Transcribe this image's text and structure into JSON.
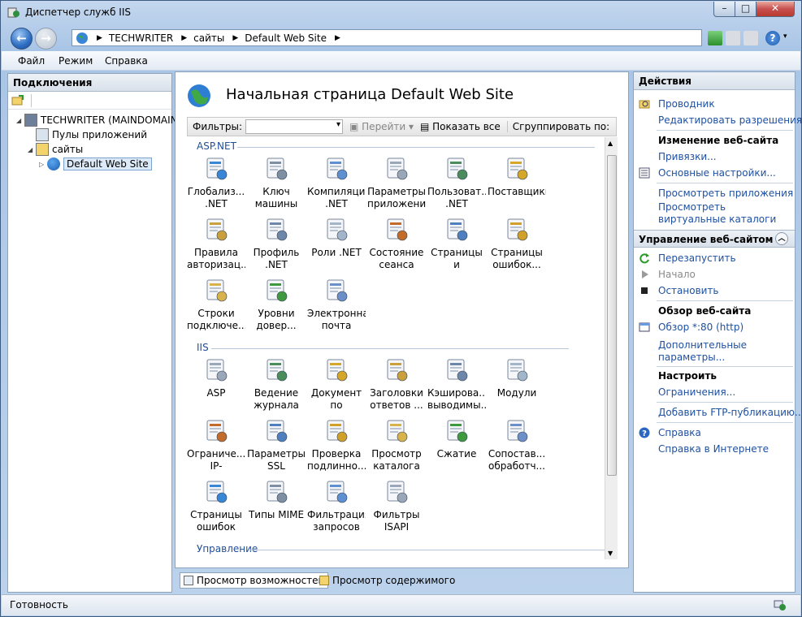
{
  "window": {
    "title": "Диспетчер служб IIS",
    "min": "–",
    "max": "□",
    "close": "✕"
  },
  "address": {
    "crumbs": [
      "TECHWRITER",
      "сайты",
      "Default Web Site"
    ]
  },
  "menu": [
    "Файл",
    "Режим",
    "Справка"
  ],
  "connections": {
    "title": "Подключения",
    "tree": [
      {
        "label": "TECHWRITER (MAINDOMAIN",
        "indent": 0,
        "icon": "server-icon"
      },
      {
        "label": "Пулы приложений",
        "indent": 1,
        "icon": "app-pool-icon"
      },
      {
        "label": "сайты",
        "indent": 1,
        "icon": "sites-folder-icon"
      },
      {
        "label": "Default Web Site",
        "indent": 2,
        "icon": "website-globe-icon",
        "selected": true
      }
    ]
  },
  "center": {
    "title": "Начальная страница Default Web Site",
    "filter_label": "Фильтры:",
    "go_label": "Перейти",
    "show_all_label": "Показать все",
    "group_label": "Сгруппировать по:",
    "groups": [
      {
        "name": "ASP.NET",
        "items": [
          {
            "label": "Глобализ... .NET",
            "icon": "globalization-icon"
          },
          {
            "label": "Ключ машины",
            "icon": "machine-key-icon"
          },
          {
            "label": "Компиляция .NET",
            "icon": "compilation-icon"
          },
          {
            "label": "Параметры приложения",
            "icon": "app-settings-icon"
          },
          {
            "label": "Пользоват... .NET",
            "icon": "net-users-icon"
          },
          {
            "label": "Поставщики",
            "icon": "providers-icon"
          },
          {
            "label": "Правила авторизац...",
            "icon": "authorization-rules-icon"
          },
          {
            "label": "Профиль .NET",
            "icon": "net-profile-icon"
          },
          {
            "label": "Роли .NET",
            "icon": "net-roles-icon"
          },
          {
            "label": "Состояние сеанса",
            "icon": "session-state-icon"
          },
          {
            "label": "Страницы и элементы...",
            "icon": "pages-controls-icon"
          },
          {
            "label": "Страницы ошибок...",
            "icon": "error-pages-net-icon"
          },
          {
            "label": "Строки подключе...",
            "icon": "connection-strings-icon"
          },
          {
            "label": "Уровни довер...",
            "icon": "trust-levels-icon"
          },
          {
            "label": "Электронная почта (SM...",
            "icon": "smtp-email-icon"
          }
        ]
      },
      {
        "name": "IIS",
        "items": [
          {
            "label": "ASP",
            "icon": "asp-icon"
          },
          {
            "label": "Ведение журнала",
            "icon": "logging-icon"
          },
          {
            "label": "Документ по умолчанию",
            "icon": "default-document-icon"
          },
          {
            "label": "Заголовки ответов ...",
            "icon": "response-headers-icon"
          },
          {
            "label": "Кэширова... выводимы...",
            "icon": "output-caching-icon"
          },
          {
            "label": "Модули",
            "icon": "modules-icon"
          },
          {
            "label": "Ограниче... IP-адресов...",
            "icon": "ip-restrictions-icon"
          },
          {
            "label": "Параметры SSL",
            "icon": "ssl-settings-icon"
          },
          {
            "label": "Проверка подлинно...",
            "icon": "authentication-icon"
          },
          {
            "label": "Просмотр каталога",
            "icon": "directory-browsing-icon"
          },
          {
            "label": "Сжатие",
            "icon": "compression-icon"
          },
          {
            "label": "Сопостав... обработч...",
            "icon": "handler-mappings-icon"
          },
          {
            "label": "Страницы ошибок",
            "icon": "error-pages-icon"
          },
          {
            "label": "Типы MIME",
            "icon": "mime-types-icon"
          },
          {
            "label": "Фильтрация запросов",
            "icon": "request-filtering-icon"
          },
          {
            "label": "Фильтры ISAPI",
            "icon": "isapi-filters-icon"
          }
        ]
      },
      {
        "name": "Управление",
        "items": []
      }
    ]
  },
  "tabs": {
    "features": "Просмотр возможностей",
    "content": "Просмотр содержимого"
  },
  "actions": {
    "title": "Действия",
    "explore": "Проводник",
    "edit_permissions": "Редактировать разрешения...",
    "edit_site_header": "Изменение веб-сайта",
    "bindings": "Привязки...",
    "basic_settings": "Основные настройки...",
    "view_apps": "Просмотреть приложения",
    "view_vdirs": "Просмотреть виртуальные каталоги",
    "manage_header": "Управление веб-сайтом",
    "restart": "Перезапустить",
    "start": "Начало",
    "stop": "Остановить",
    "browse_header": "Обзор веб-сайта",
    "browse_80": "Обзор *:80 (http)",
    "advanced": "Дополнительные параметры...",
    "configure_header": "Настроить",
    "limits": "Ограничения...",
    "ftp": "Добавить FTP-публикацию...",
    "help": "Справка",
    "online_help": "Справка в Интернете"
  },
  "status": "Готовность"
}
